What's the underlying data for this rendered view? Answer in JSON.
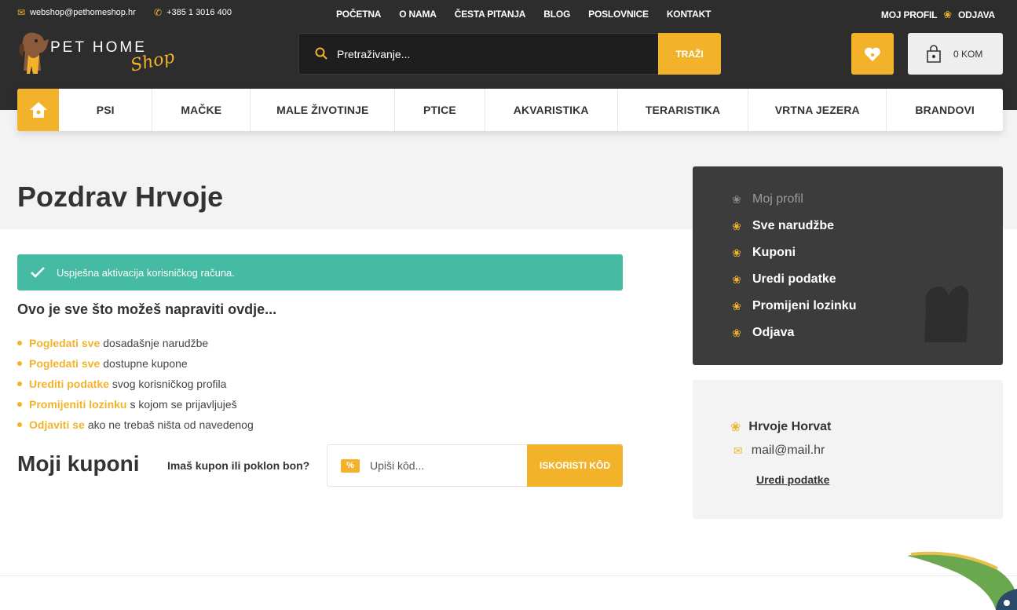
{
  "header": {
    "email": "webshop@pethomeshop.hr",
    "phone": "+385 1 3016 400",
    "top_nav": [
      "POČETNA",
      "O NAMA",
      "ČESTA PITANJA",
      "BLOG",
      "POSLOVNICE",
      "KONTAKT"
    ],
    "profile_label": "MOJ PROFIL",
    "logout_label": "ODJAVA",
    "logo_text": "PET HOME",
    "logo_script": "Shop",
    "search_placeholder": "Pretraživanje...",
    "search_button": "TRAŽI",
    "cart_label": "0 KOM"
  },
  "main_nav": [
    "PSI",
    "MAČKE",
    "MALE ŽIVOTINJE",
    "PTICE",
    "AKVARISTIKA",
    "TERARISTIKA",
    "VRTNA JEZERA",
    "BRANDOVI"
  ],
  "main": {
    "title": "Pozdrav Hrvoje",
    "alert": "Uspješna aktivacija korisničkog računa.",
    "subheading": "Ovo je sve što možeš napraviti ovdje...",
    "actions": [
      {
        "link": "Pogledati sve",
        "text": "dosadašnje narudžbe"
      },
      {
        "link": "Pogledati sve",
        "text": "dostupne kupone"
      },
      {
        "link": "Urediti podatke",
        "text": "svog korisničkog profila"
      },
      {
        "link": "Promijeniti lozinku",
        "text": "s kojom se prijavljuješ"
      },
      {
        "link": "Odjaviti se",
        "text": "ako ne trebaš ništa od navedenog"
      }
    ],
    "coupons_title": "Moji kuponi",
    "coupon_question": "Imaš kupon ili poklon bon?",
    "coupon_placeholder": "Upiši kôd...",
    "coupon_button": "ISKORISTI KÔD"
  },
  "sidebar": {
    "menu": [
      "Moj profil",
      "Sve narudžbe",
      "Kuponi",
      "Uredi podatke",
      "Promijeni lozinku",
      "Odjava"
    ],
    "user_name": "Hrvoje Horvat",
    "user_email": "mail@mail.hr",
    "edit_link": "Uredi podatke"
  },
  "colors": {
    "accent": "#f2b32b",
    "dark": "#2e2d2d",
    "success": "#46bba3"
  }
}
